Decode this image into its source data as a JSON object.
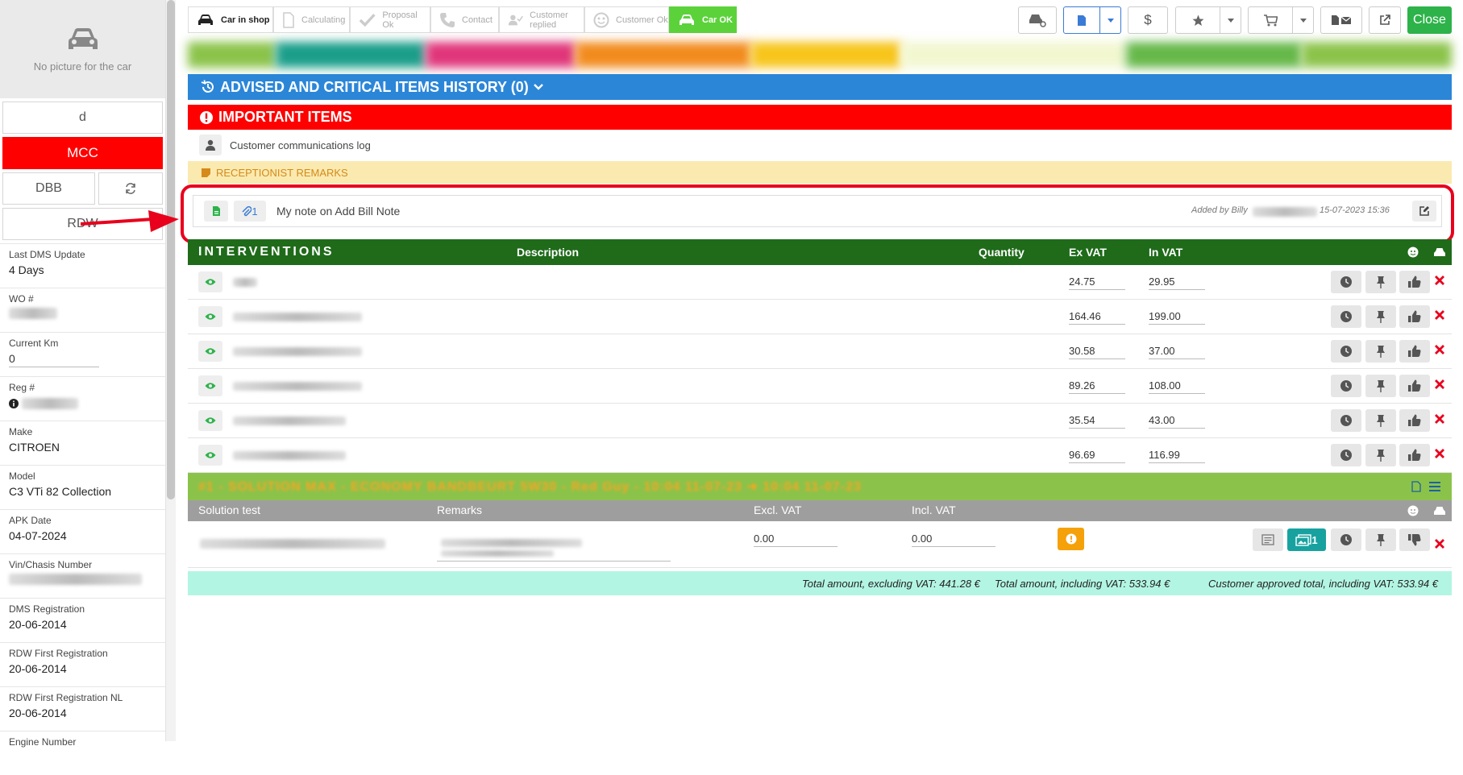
{
  "sidebar": {
    "no_picture": "No picture for the car",
    "btn_d": "d",
    "btn_mcc": "MCC",
    "btn_dbb": "DBB",
    "btn_rdw": "RDW",
    "fields": [
      {
        "label": "Last DMS Update",
        "value": "4 Days"
      },
      {
        "label": "WO #",
        "value": ""
      },
      {
        "label": "Current Km",
        "value": "0"
      },
      {
        "label": "Reg #",
        "value": ""
      },
      {
        "label": "Make",
        "value": "CITROEN"
      },
      {
        "label": "Model",
        "value": "C3 VTi 82 Collection"
      },
      {
        "label": "APK Date",
        "value": "04-07-2024"
      },
      {
        "label": "Vin/Chasis Number",
        "value": ""
      },
      {
        "label": "DMS Registration",
        "value": "20-06-2014"
      },
      {
        "label": "RDW First Registration",
        "value": "20-06-2014"
      },
      {
        "label": "RDW First Registration NL",
        "value": "20-06-2014"
      },
      {
        "label": "Engine Number",
        "value": ""
      }
    ]
  },
  "steps": [
    "Car in shop",
    "Calculating",
    "Proposal Ok",
    "Contact",
    "Customer replied",
    "Customer Ok",
    "Car OK"
  ],
  "toolbar": {
    "close": "Close",
    "dollar": "$"
  },
  "advised_header": "ADVISED AND CRITICAL ITEMS HISTORY (0)",
  "important_header": "IMPORTANT ITEMS",
  "comm_log": "Customer communications log",
  "receptionist": "RECEPTIONIST REMARKS",
  "note": {
    "attach_count": "1",
    "text": "My note on Add Bill Note",
    "added_by": "Added by Billy",
    "datetime": "15-07-2023 15:36"
  },
  "interventions": {
    "title": "INTERVENTIONS",
    "col_description": "Description",
    "col_quantity": "Quantity",
    "col_exvat": "Ex VAT",
    "col_invat": "In VAT",
    "rows": [
      {
        "ex": "24.75",
        "in": "29.95"
      },
      {
        "ex": "164.46",
        "in": "199.00"
      },
      {
        "ex": "30.58",
        "in": "37.00"
      },
      {
        "ex": "89.26",
        "in": "108.00"
      },
      {
        "ex": "35.54",
        "in": "43.00"
      },
      {
        "ex": "96.69",
        "in": "116.99"
      }
    ]
  },
  "solution": {
    "title": "#1 - SOLUTION MAX - ECONOMY BANDBEURT 5W30 - Red Guy - 10:04 11-07-23 ➜ 10:04 11-07-23",
    "col_test": "Solution test",
    "col_remarks": "Remarks",
    "col_excl": "Excl. VAT",
    "col_incl": "Incl. VAT",
    "excl": "0.00",
    "incl": "0.00",
    "photo_count": "1"
  },
  "totals": {
    "excl": "Total amount, excluding VAT: 441.28 €",
    "incl": "Total amount, including VAT: 533.94 €",
    "approved": "Customer approved total, including VAT: 533.94 €"
  },
  "colors": {
    "green_header": "#1f6b1a",
    "blue_header": "#2b86d8",
    "red_header": "#ff0000",
    "close": "#2db34a",
    "solution": "#8bc34a"
  }
}
